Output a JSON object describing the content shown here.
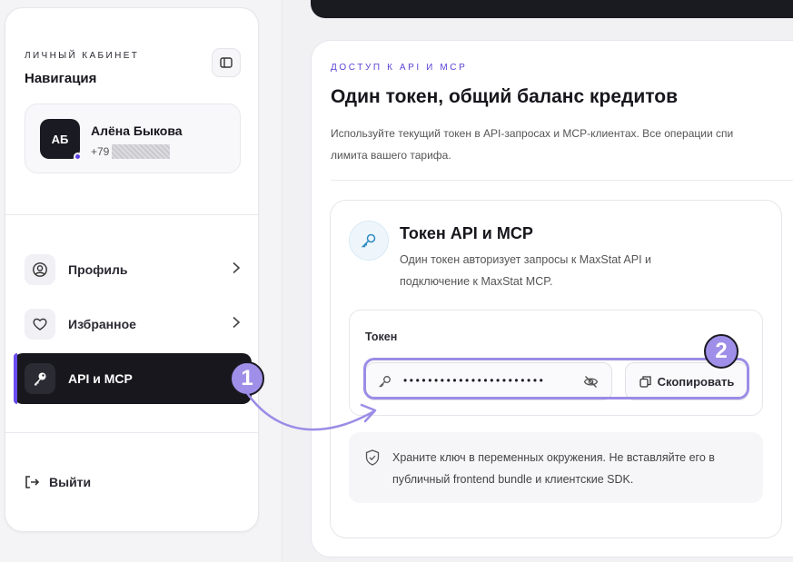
{
  "sidebar": {
    "eyebrow": "ЛИЧНЫЙ КАБИНЕТ",
    "title": "Навигация",
    "user": {
      "initials": "АБ",
      "name": "Алёна Быкова",
      "phone_prefix": "+79"
    },
    "nav": [
      {
        "label": "Профиль",
        "icon": "user-circle-icon"
      },
      {
        "label": "Избранное",
        "icon": "heart-icon"
      },
      {
        "label": "API и MCP",
        "icon": "key-icon",
        "active": true
      }
    ],
    "logout_label": "Выйти"
  },
  "main": {
    "eyebrow": "ДОСТУП К API И MCP",
    "title": "Один токен, общий баланс кредитов",
    "desc_line1": "Используйте текущий токен в API-запросах и MCP-клиентах. Все операции спи",
    "desc_line2": "лимита вашего тарифа.",
    "token_card": {
      "title": "Токен API и MCP",
      "desc": "Один токен авторизует запросы к MaxStat API и подключение к MaxStat MCP.",
      "field_label": "Токен",
      "token_masked": "•••••••••••••••••••••••",
      "copy_label": "Скопировать",
      "note": "Храните ключ в переменных окружения. Не вставляйте его в публичный frontend bundle и клиентские SDK."
    }
  },
  "annotations": {
    "badge1": "1",
    "badge2": "2"
  },
  "colors": {
    "accent": "#6a4cf0",
    "annotation": "#a08fe8",
    "dark": "#17171d"
  }
}
